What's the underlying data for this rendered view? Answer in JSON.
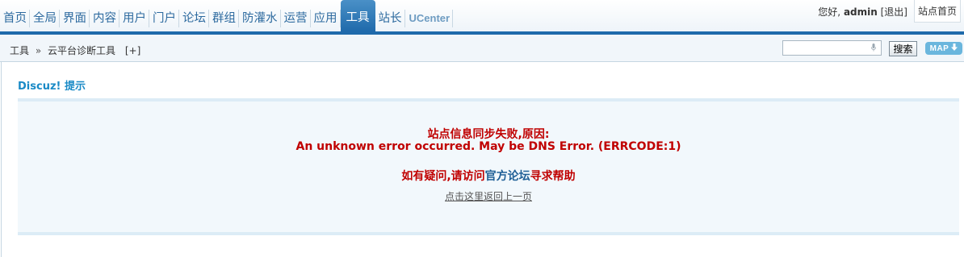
{
  "nav": {
    "items": [
      {
        "label": "首页"
      },
      {
        "label": "全局"
      },
      {
        "label": "界面"
      },
      {
        "label": "内容"
      },
      {
        "label": "用户"
      },
      {
        "label": "门户"
      },
      {
        "label": "论坛"
      },
      {
        "label": "群组"
      },
      {
        "label": "防灌水"
      },
      {
        "label": "运营"
      },
      {
        "label": "应用"
      },
      {
        "label": "工具"
      },
      {
        "label": "站长"
      },
      {
        "label": "UCenter"
      }
    ],
    "active_label": "工具"
  },
  "user": {
    "greeting_prefix": "您好,",
    "username": "admin",
    "logout_label": "[退出]",
    "home_label": "站点首页"
  },
  "breadcrumb": {
    "root": "工具",
    "separator": "»",
    "current": "云平台诊断工具",
    "add_label": "[+]"
  },
  "search": {
    "value": "",
    "button_label": "搜索"
  },
  "map_button": {
    "label": "MAP",
    "arrow": "➔"
  },
  "panel": {
    "title": "Discuz! 提示"
  },
  "message": {
    "line1": "站点信息同步失败,原因:",
    "line2": "An unknown error occurred. May be DNS Error. (ERRCODE:1)",
    "help_prefix": "如有疑问,请访问",
    "help_link": "官方论坛",
    "help_suffix": "寻求帮助",
    "back_link": "点击这里返回上一页"
  },
  "colors": {
    "accent": "#1f6aab",
    "error_text": "#c00000",
    "panel_title": "#1a8ac6",
    "notice_bg": "#f2f8fc"
  }
}
